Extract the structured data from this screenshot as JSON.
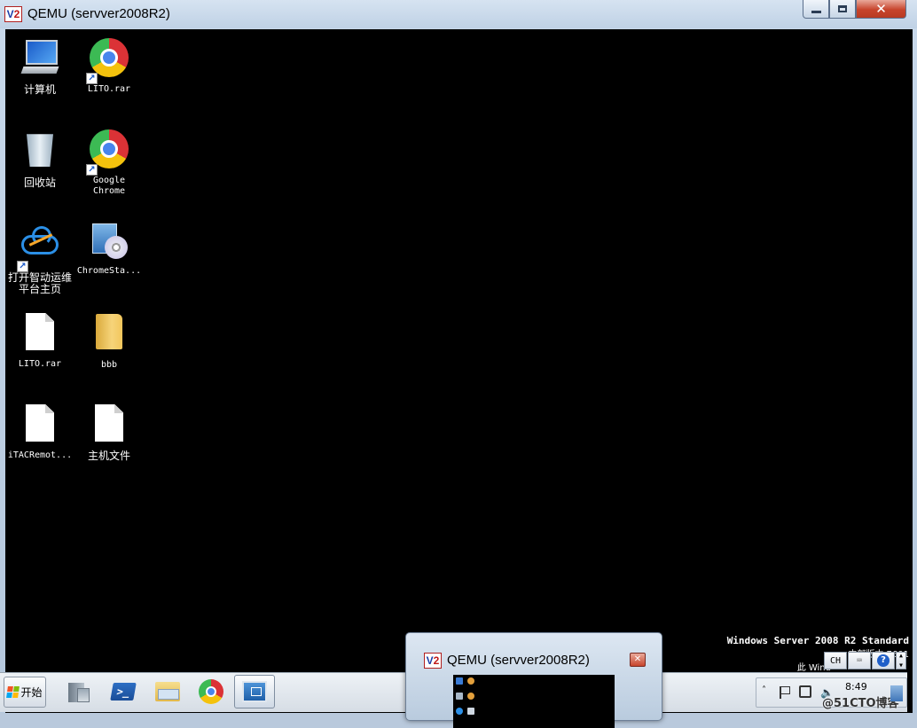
{
  "window": {
    "title": "QEMU (servver2008R2)",
    "badge_v": "V",
    "badge_n": "2"
  },
  "desktop": {
    "icons": [
      {
        "label": "计算机",
        "icon": "computer-icon"
      },
      {
        "label": "LITO.rar",
        "icon": "chrome-icon"
      },
      {
        "label": "回收站",
        "icon": "recycle-bin-icon"
      },
      {
        "label": "Google\nChrome",
        "icon": "chrome-icon"
      },
      {
        "label": "打开智动运维\n平台主页",
        "icon": "cloud-icon"
      },
      {
        "label": "ChromeSta...",
        "icon": "installer-icon"
      },
      {
        "label": "LITO.rar",
        "icon": "document-icon"
      },
      {
        "label": "bbb",
        "icon": "folder-icon"
      },
      {
        "label": "iTACRemot...",
        "icon": "document-icon"
      },
      {
        "label": "主机文件",
        "icon": "document-icon"
      }
    ],
    "watermark_line1": "Windows Server 2008 R2 Standard",
    "watermark_line2": "内部版本 7601",
    "watermark_line3": "此 Wind"
  },
  "taskbar": {
    "start_label": "开始",
    "language": "CH",
    "help": "?",
    "clock": "8:49",
    "credit": "@51CTO博客",
    "tray_expand": "˄"
  },
  "thumbnail": {
    "title": "QEMU (servver2008R2)",
    "close": "✕"
  },
  "colors": {
    "desktop_bg": "#000000",
    "frame": "#c8d8ea",
    "close_red": "#c7442c"
  }
}
